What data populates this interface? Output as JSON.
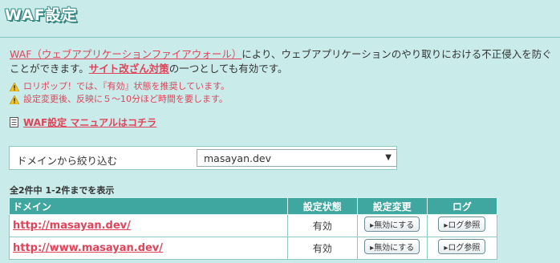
{
  "page": {
    "title": "WAF設定"
  },
  "intro": {
    "waf_link": "WAF（ウェブアプリケーションファイアウォール）",
    "text1": "により、ウェブアプリケーションのやり取りにおける不正侵入を防ぐことができます。",
    "attack_link": "サイト改ざん対策",
    "text2": "の一つとしても有効です。"
  },
  "notes": [
    "ロリポップ！では、『有効』状態を推奨しています。",
    "設定変更後、反映に５～10分ほど時間を要します。"
  ],
  "manual_link": "WAF設定 マニュアルはコチラ",
  "filter": {
    "label": "ドメインから絞り込む",
    "selected": "masayan.dev"
  },
  "count_text": "全2件中 1-2件までを表示",
  "table": {
    "headers": [
      "ドメイン",
      "設定状態",
      "設定変更",
      "ログ"
    ],
    "rows": [
      {
        "domain": "http://masayan.dev/",
        "status": "有効",
        "change": "無効にする",
        "log": "ログ参照"
      },
      {
        "domain": "http://www.masayan.dev/",
        "status": "有効",
        "change": "無効にする",
        "log": "ログ参照"
      }
    ]
  },
  "colors": {
    "accent": "#e0445a",
    "header": "#3fa6a0",
    "bg": "#c9ecea"
  },
  "icons": [
    "warning-icon",
    "document-icon",
    "chevron-down-icon",
    "play-right-icon"
  ]
}
